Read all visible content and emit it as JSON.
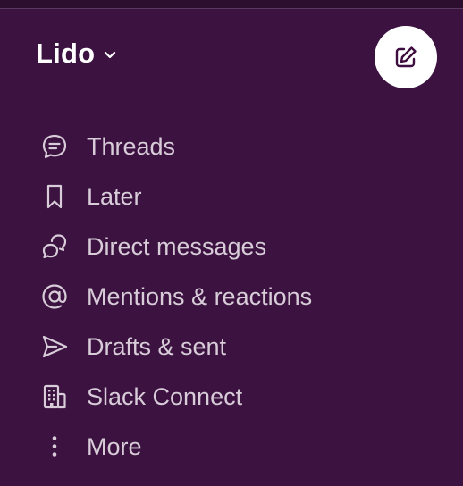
{
  "workspace": {
    "name": "Lido"
  },
  "nav": {
    "items": [
      {
        "label": "Threads",
        "icon": "threads-icon"
      },
      {
        "label": "Later",
        "icon": "bookmark-icon"
      },
      {
        "label": "Direct messages",
        "icon": "direct-messages-icon"
      },
      {
        "label": "Mentions & reactions",
        "icon": "at-sign-icon"
      },
      {
        "label": "Drafts & sent",
        "icon": "send-icon"
      },
      {
        "label": "Slack Connect",
        "icon": "building-icon"
      },
      {
        "label": "More",
        "icon": "more-vertical-icon"
      }
    ]
  },
  "colors": {
    "sidebar_bg": "#3b1240",
    "text": "#d8ccd9",
    "compose_icon": "#3f0e40"
  }
}
